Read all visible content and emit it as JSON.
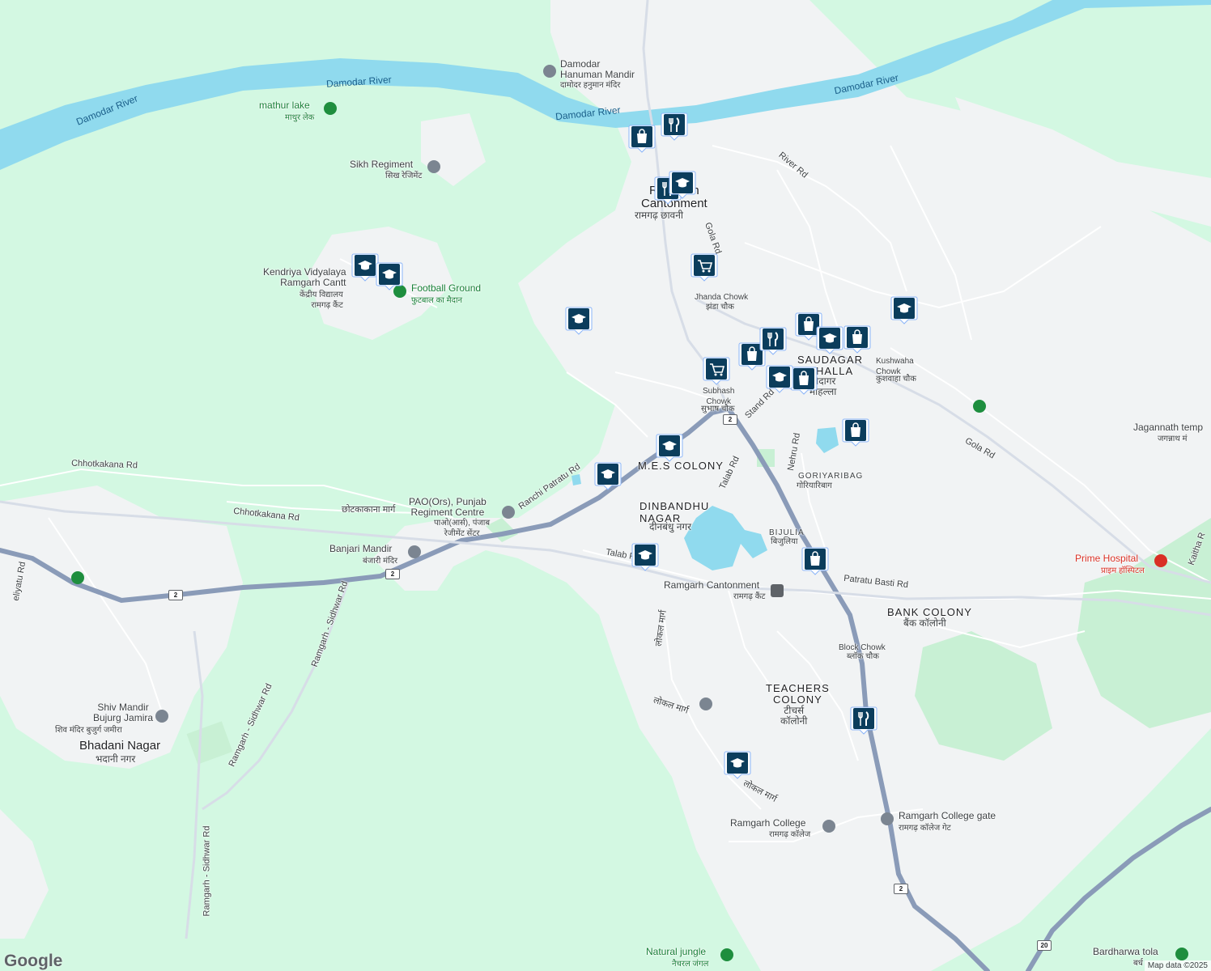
{
  "map": {
    "colors": {
      "land": "#d3f8e2",
      "urban": "#f1f3f4",
      "water": "#90daee",
      "highway": "#8a9bb8",
      "road": "#ffffff",
      "pin": "#1a73e8"
    },
    "attribution": "Map data ©2025",
    "logo": "Google"
  },
  "labels": {
    "damodar_river_1": "Damodar River",
    "damodar_river_2": "Damodar River",
    "damodar_river_3": "Damodar River",
    "damodar_river_4": "Damodar River",
    "hanuman_mandir": "Damodar\nHanuman Mandir",
    "hanuman_mandir_hi": "दामोदर हनुमान मंदिर",
    "mathur_lake": "mathur lake",
    "mathur_lake_hi": "माथुर लेक",
    "sikh_regiment": "Sikh Regiment",
    "sikh_regiment_hi": "सिख रेजिमेंट",
    "ramgarh_cantonment_top": "Ramgarh\nCantonment",
    "ramgarh_cantonment_top_hi": "रामगढ़ छावनी",
    "river_rd": "River Rd",
    "gola_rd_top": "Gola Rd",
    "kendriya": "Kendriya Vidyalaya\nRamgarh Cantt",
    "kendriya_hi": "केंद्रीय विद्यालय\nरामगढ़ कैंट",
    "football_ground": "Football Ground",
    "football_ground_hi": "फुटबाल का मैदान",
    "jhanda_chowk": "Jhanda Chowk",
    "jhanda_chowk_hi": "झंडा चौक",
    "saudagar": "SAUDAGAR\nMOHALLA",
    "saudagar_hi": "सौदागर\nमोहल्ला",
    "kushwaha_chowk": "Kushwaha\nChowk",
    "kushwaha_chowk_hi": "कुशवाहा चौक",
    "subhash_chowk": "Subhash\nChowk",
    "subhash_chowk_hi": "सुभाष चौक",
    "stand_rd": "Stand Rd",
    "nehru_rd": "Nehru Rd",
    "gola_rd": "Gola Rd",
    "jagannath": "Jagannath temp",
    "jagannath_hi": "जगन्नाथ मं",
    "chhotkakana_rd_1": "Chhotkakana Rd",
    "chhotkakana_rd_2": "Chhotkakana Rd",
    "chhotkakana_hi": "छोटकाकाना मार्ग",
    "mes_colony": "M.E.S COLONY",
    "talab_rd_1": "Talab Rd",
    "talab_rd_2": "Talab Rd",
    "goriyaribag": "GORIYARIBAG",
    "goriyaribag_hi": "गोरियारिबाग",
    "pao": "PAO(Ors), Punjab\nRegiment Centre",
    "pao_hi": "पाओ(आर्स), पंजाब\nरेजीमेंट सेंटर",
    "ranchi_patratu": "Ranchi Patratu Rd",
    "dinbandhu": "DINBANDHU\nNAGAR",
    "dinbandhu_hi": "दीनबंधु नगर",
    "bijulia": "BIJULIA",
    "bijulia_hi": "बिजुलिया",
    "banjari": "Banjari Mandir",
    "banjari_hi": "बंजारी मंदिर",
    "ramgarh_cantonment_stn": "Ramgarh Cantonment",
    "ramgarh_cantonment_stn_hi": "रामगढ़ कैंट",
    "patratu_basti": "Patratu Basti Rd",
    "bank_colony": "BANK COLONY",
    "bank_colony_hi": "बैंक कॉलोनी",
    "prime_hospital": "Prime Hospital",
    "prime_hospital_hi": "प्राइम हॉस्पिटल",
    "kaitha": "Kaitha R",
    "block_chowk": "Block Chowk",
    "block_chowk_hi": "ब्लॉक चौक",
    "teachers_colony": "TEACHERS\nCOLONY",
    "teachers_colony_hi": "टीचर्स\nकॉलोनी",
    "local_marg_1": "लोकल मार्ग",
    "local_marg_2": "लोकल मार्ग",
    "local_marg_3": "लोकल मार्ग",
    "shiv_mandir": "Shiv Mandir\nBujurg Jamira",
    "shiv_mandir_hi": "शिव मंदिर बुजुर्ग जमीरा",
    "bhadani": "Bhadani Nagar",
    "bhadani_hi": "भदानी नगर",
    "ramgarh_sidhwar_1": "Ramgarh - Sidhwar Rd",
    "ramgarh_sidhwar_2": "Ramgarh - Sidhwar Rd",
    "ramgarh_sidhwar_3": "Ramgarh - Sidhwar Rd",
    "ramgarh_college": "Ramgarh College",
    "ramgarh_college_hi": "रामगढ़ कॉलेज",
    "college_gate": "Ramgarh College gate",
    "college_gate_hi": "रामगढ़ कॉलेज गेट",
    "natural_jungle": "Natural jungle",
    "natural_jungle_hi": "नैचरल जंगल",
    "bardharwa": "Bardharwa tola",
    "bardharwa_hi": "बर्ध",
    "beliyatu": "eliyatu Rd",
    "nh2_a": "2",
    "nh2_b": "2",
    "nh2_c": "2",
    "nh2_d": "2",
    "nh20": "20"
  },
  "markers": [
    {
      "icon": "shopping-bag-icon"
    },
    {
      "icon": "restaurant-icon"
    },
    {
      "icon": "restaurant-icon"
    },
    {
      "icon": "school-icon"
    },
    {
      "icon": "shopping-cart-icon"
    },
    {
      "icon": "school-icon"
    },
    {
      "icon": "school-icon"
    },
    {
      "icon": "school-icon"
    },
    {
      "icon": "shopping-cart-icon"
    },
    {
      "icon": "shopping-bag-icon"
    },
    {
      "icon": "restaurant-icon"
    },
    {
      "icon": "shopping-bag-icon"
    },
    {
      "icon": "school-icon"
    },
    {
      "icon": "shopping-bag-icon"
    },
    {
      "icon": "school-icon"
    },
    {
      "icon": "shopping-bag-icon"
    },
    {
      "icon": "school-icon"
    },
    {
      "icon": "shopping-bag-icon"
    },
    {
      "icon": "school-icon"
    },
    {
      "icon": "school-icon"
    },
    {
      "icon": "school-icon"
    },
    {
      "icon": "shopping-bag-icon"
    },
    {
      "icon": "restaurant-icon"
    },
    {
      "icon": "school-icon"
    }
  ]
}
